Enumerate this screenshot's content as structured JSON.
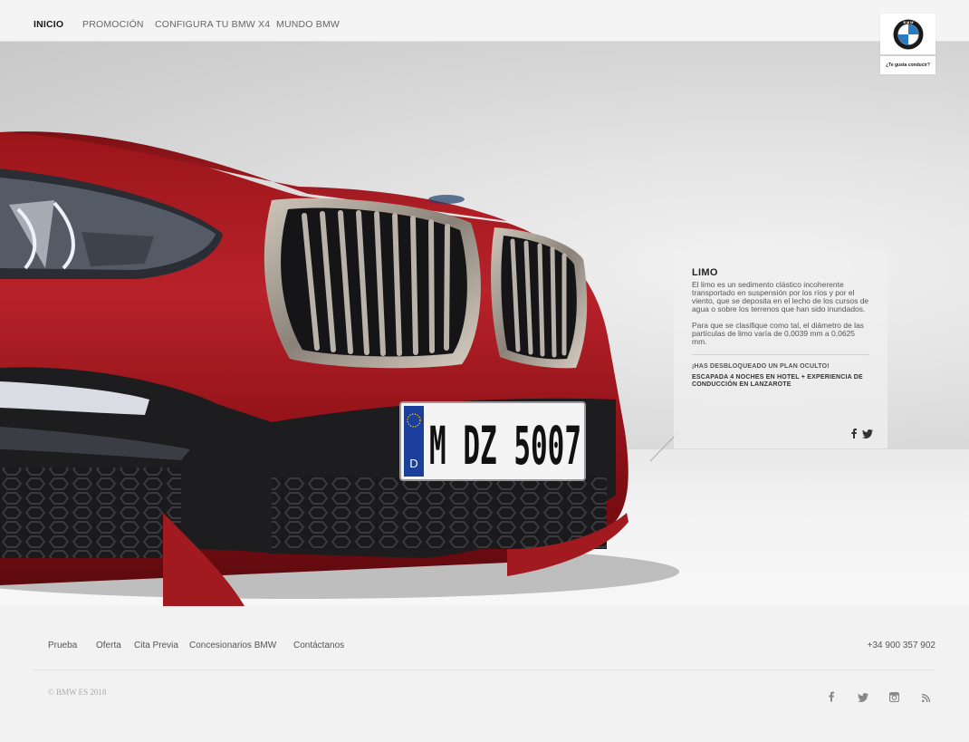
{
  "nav": {
    "items": [
      {
        "label": "INICIO",
        "active": true
      },
      {
        "label": "PROMOCIÓN",
        "active": false
      },
      {
        "label": "CONFIGURA TU BMW X4",
        "active": false
      },
      {
        "label": "MUNDO BMW",
        "active": false
      }
    ]
  },
  "brand": {
    "logo_icon": "bmw-roundel",
    "claim": "¿Te gusta conducir?"
  },
  "hero": {
    "plate": "M DZ 5007",
    "plate_country": "D"
  },
  "info": {
    "title": "LIMO",
    "paragraph1": "El limo es un sedimento clástico incoherente transportado en suspensión por los ríos y por el viento, que se deposita en el lecho de los cursos de agua o sobre los terrenos que han sido inundados.",
    "paragraph2": "Para que se clasifique como tal, el diámetro de las partículas de limo varía de 0,0039 mm a 0,0625 mm.",
    "unlock": "¡HAS DESBLOQUEADO UN PLAN OCULTO!",
    "plan": "ESCAPADA 4 NOCHES EN HOTEL + EXPERIENCIA DE CONDUCCIÓN EN LANZAROTE",
    "social": [
      "facebook-icon",
      "twitter-icon"
    ]
  },
  "footer": {
    "links": [
      "Prueba",
      "Oferta",
      "Cita Previa",
      "Concesionarios BMW",
      "Contáctanos"
    ],
    "phone": "+34 900 357 902",
    "copyright": "© BMW ES 2018",
    "social": [
      "facebook-icon",
      "twitter-icon",
      "instagram-icon",
      "rss-icon"
    ]
  }
}
